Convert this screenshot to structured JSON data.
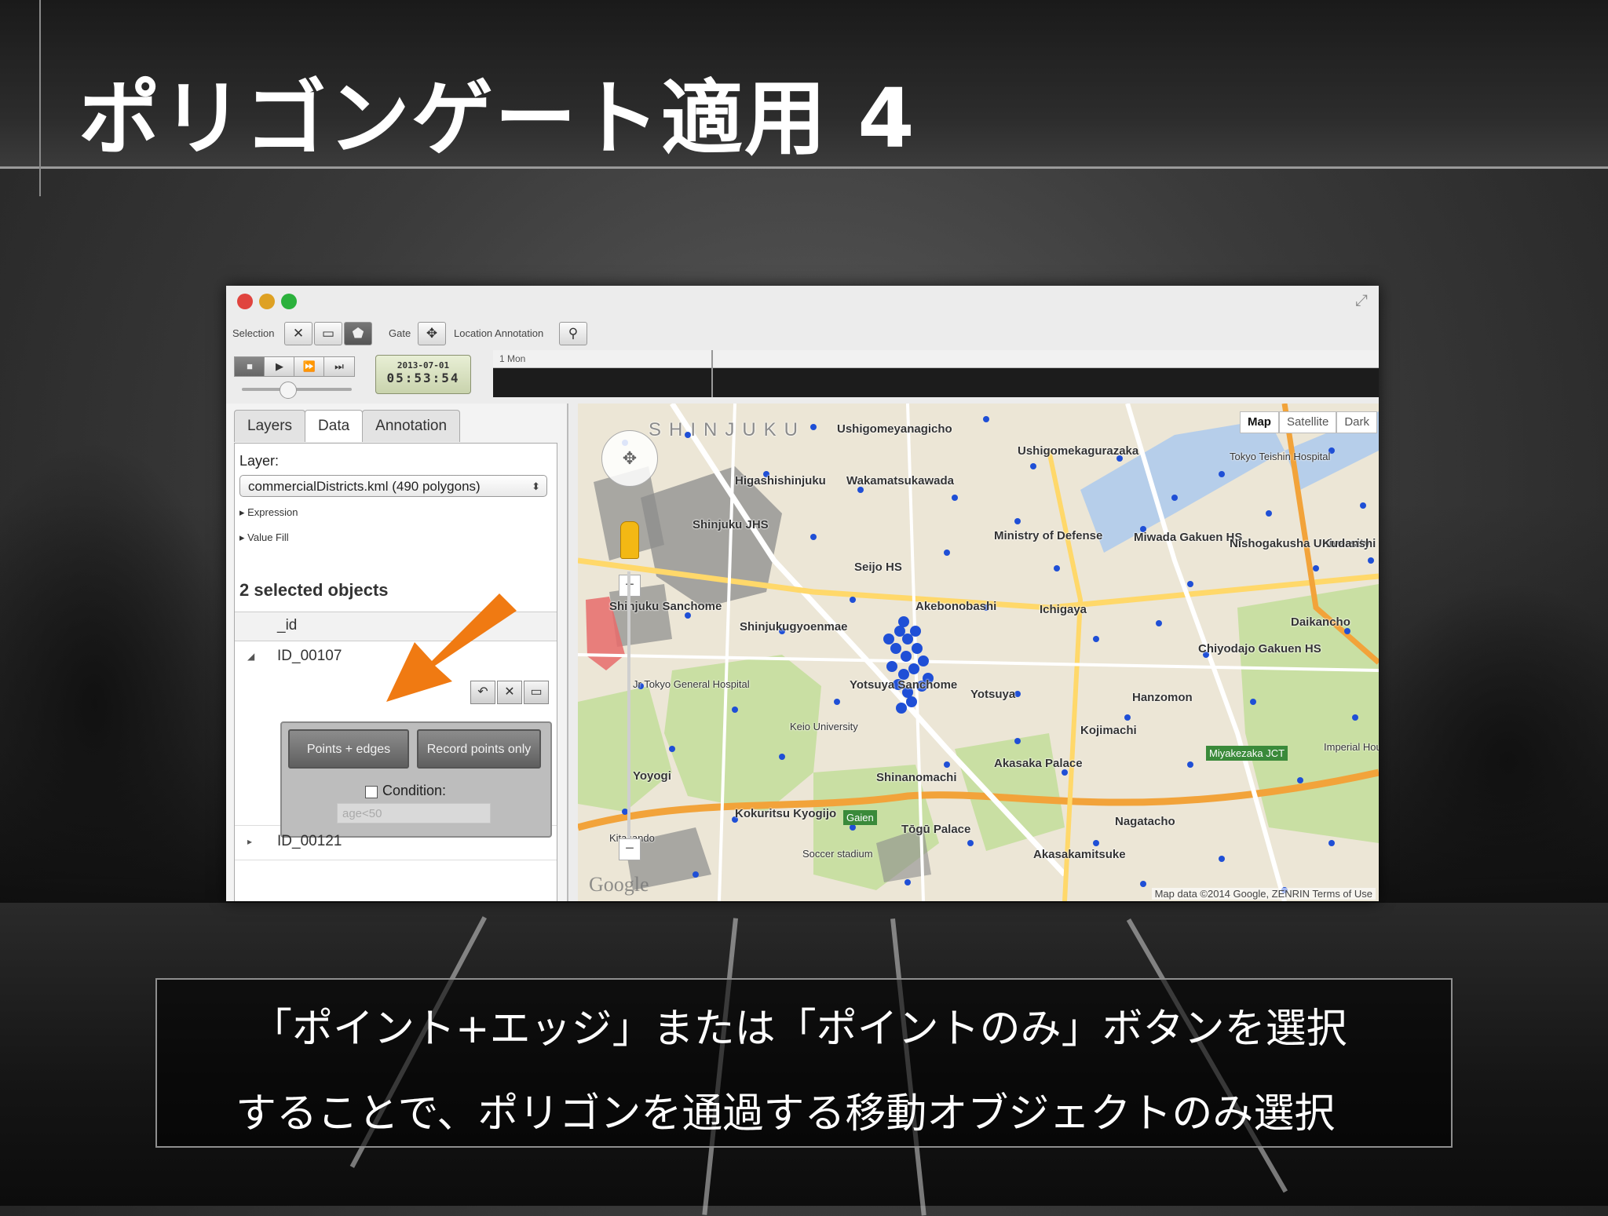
{
  "slide": {
    "title": "ポリゴンゲート適用 4",
    "caption_line1": "「ポイント+エッジ」または「ポイントのみ」ボタンを選択",
    "caption_line2": "することで、ポリゴンを通過する移動オブジェクトのみ選択"
  },
  "toolbar": {
    "selection_label": "Selection",
    "gate_label": "Gate",
    "location_annotation_label": "Location Annotation",
    "icons": [
      "close-icon",
      "rect-select-icon",
      "polygon-select-icon",
      "gate-move-icon",
      "pin-icon"
    ]
  },
  "playback": {
    "date": "2013-07-01",
    "time": "05:53:54",
    "timeline_label": "1 Mon"
  },
  "panel": {
    "tabs": [
      "Layers",
      "Data",
      "Annotation"
    ],
    "active_tab": "Data",
    "layer_label": "Layer:",
    "layer_value": "commercialDistricts.kml (490 polygons)",
    "expression_label": "Expression",
    "value_fill_label": "Value Fill",
    "selected_heading": "2 selected objects",
    "column_header": "_id",
    "rows": [
      "ID_00107",
      "ID_00121"
    ],
    "gate_popup": {
      "points_edges_label": "Points + edges",
      "record_points_label": "Record points only",
      "condition_label": "Condition:",
      "condition_placeholder": "age<50"
    }
  },
  "map": {
    "map_types": [
      "Map",
      "Satellite",
      "Dark"
    ],
    "active_map_type": "Map",
    "attribution": "Map data ©2014 Google, ZENRIN   Terms of Use",
    "google_logo": "Google",
    "labels": {
      "shinjuku": "SHINJUKU",
      "ushigome_yanagicho": "Ushigomeyanagicho",
      "ushigome_kagurazaka": "Ushigomekagurazaka",
      "higashishinjuku": "Higashishinjuku",
      "wakamatsukawada": "Wakamatsukawada",
      "ministry_of_defense": "Ministry of Defense",
      "miwada": "Miwada Gakuen HS",
      "nishogakusha": "Nishogakusha University",
      "shinjuku_jhs": "Shinjuku JHS",
      "seijo_hs": "Seijo HS",
      "akebonobashi": "Akebonobashi",
      "ichigaya": "Ichigaya",
      "shinjuku_sanchome": "Shinjuku Sanchome",
      "shinjukugyoenmae": "Shinjukugyoenmae",
      "chiyodajo": "Chiyodajo Gakuen HS",
      "daikancho": "Daikancho",
      "yotsuya_sanchome": "Yotsuya Sanchome",
      "yotsuya": "Yotsuya",
      "hanzomon": "Hanzomon",
      "tokyo_hospital": "Jr Tokyo General Hospital",
      "keio_university": "Keio University",
      "akasaka_palace": "Akasaka Palace",
      "kojimachi": "Kojimachi",
      "yoyogi": "Yoyogi",
      "shinanomachi": "Shinanomachi",
      "kokuritsu_kyogijo": "Kokuritsu Kyogijo",
      "nagatacho": "Nagatacho",
      "togu_palace": "Tōgū Palace",
      "akasakamitsuke": "Akasakamitsuke",
      "soccer_stadium": "Soccer stadium",
      "kitasando": "Kitasando",
      "gaien": "Gaien",
      "miyakezaka": "Miyakezaka JCT",
      "imperial_household": "Imperial Household Agency",
      "kudanshita": "Kudanshi",
      "tokyo_teishin": "Tokyo Teishin Hospital"
    }
  },
  "colors": {
    "accent_orange": "#f07a12",
    "point_blue": "#1f4fd6",
    "polygon_gray": "#8c8c8c"
  }
}
